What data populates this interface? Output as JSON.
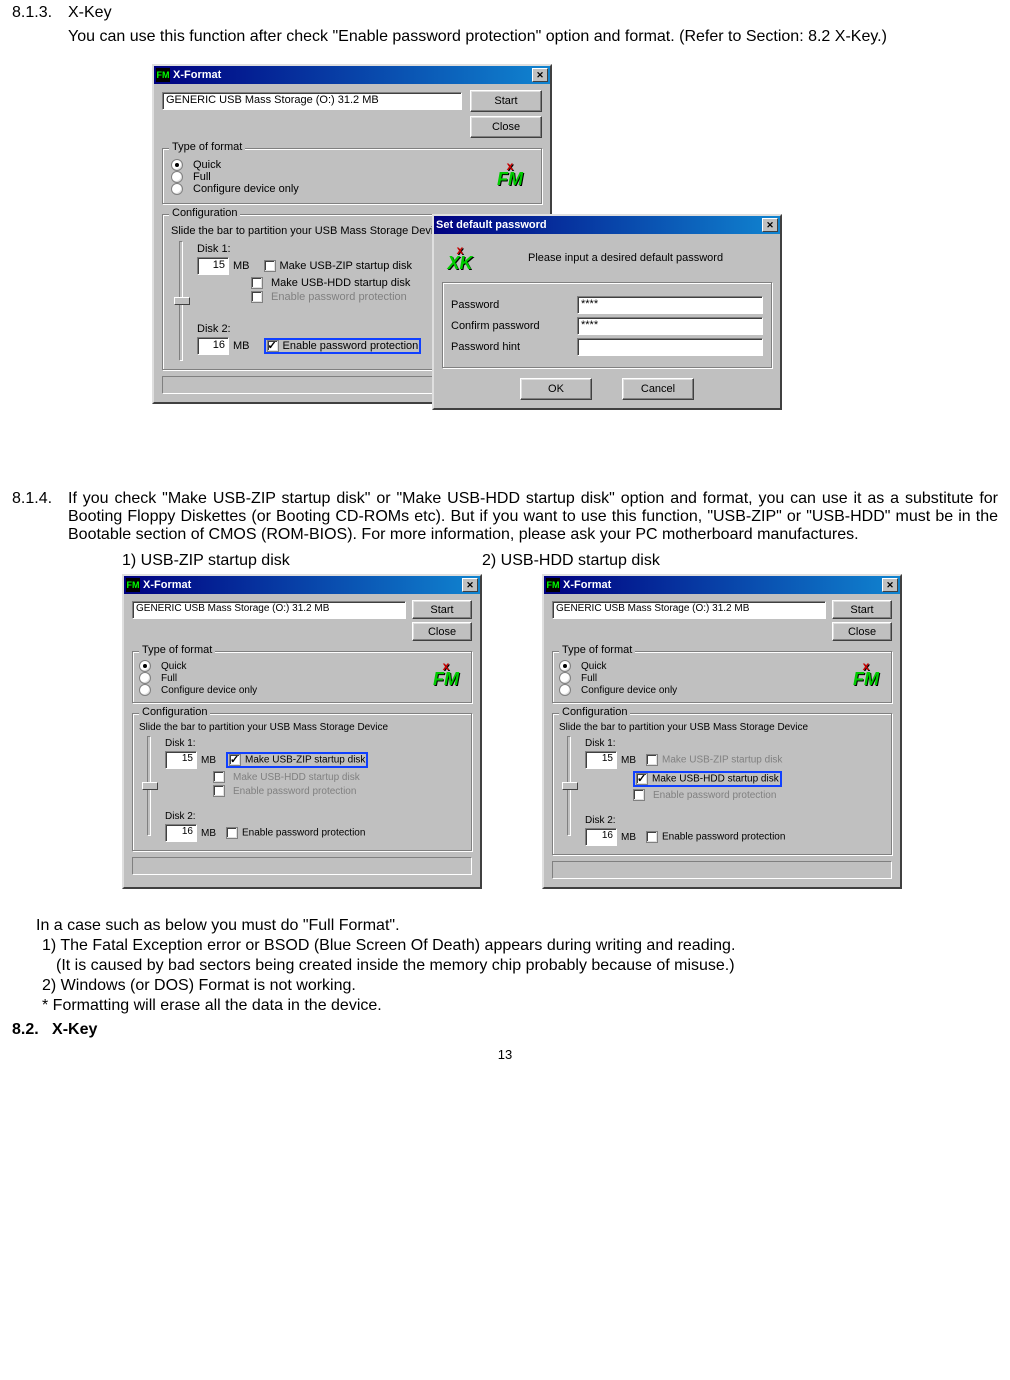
{
  "doc": {
    "sec813_num": "8.1.3.",
    "sec813_title": "X-Key",
    "sec813_body": "You can use this function after check \"Enable password protection\" option and format. (Refer to Section: 8.2 X-Key.)",
    "sec814_num": "8.1.4.",
    "sec814_body": "If you check \"Make USB-ZIP startup disk\" or \"Make USB-HDD startup disk\" option and format, you can use it as a substitute for Booting Floppy Diskettes (or Booting CD-ROMs etc). But if you want to use this function, \"USB-ZIP\" or \"USB-HDD\" must be in the Bootable section of CMOS (ROM-BIOS). For more information, please ask your PC motherboard manufactures.",
    "caption1": "1) USB-ZIP startup disk",
    "caption2": "2) USB-HDD startup disk",
    "full_format_intro": "In a case such as below you must do \"Full Format\".",
    "ff1": "1) The Fatal Exception error or BSOD (Blue Screen Of Death) appears during writing and reading.",
    "ff1_note": "(It is caused by bad sectors being created inside the memory chip probably because of misuse.)",
    "ff2": "2) Windows (or DOS) Format is not working.",
    "ff_star": "* Formatting will erase all the data in the device.",
    "sec82_num": "8.2.",
    "sec82_title": "X-Key",
    "page_number": "13"
  },
  "xformat": {
    "title": "X-Format",
    "device_label": "GENERIC USB Mass Storage (O:)  31.2 MB",
    "start_btn": "Start",
    "close_btn": "Close",
    "group_type": "Type of format",
    "opt_quick": "Quick",
    "opt_full": "Full",
    "opt_configure": "Configure device only",
    "group_conf": "Configuration",
    "conf_instr": "Slide the bar to partition your USB Mass Storage Device",
    "disk1_label": "Disk 1:",
    "disk1_val": "15",
    "mb": "MB",
    "disk2_label": "Disk 2:",
    "disk2_val": "16",
    "chk_zip": "Make USB-ZIP startup disk",
    "chk_hdd": "Make USB-HDD startup disk",
    "chk_pw": "Enable password protection",
    "logo_fm": "FM",
    "logo_x": "x"
  },
  "pw_dialog": {
    "title": "Set default password",
    "instruction": "Please input a desired default password",
    "lbl_password": "Password",
    "lbl_confirm": "Confirm password",
    "lbl_hint": "Password hint",
    "val_password": "****",
    "val_confirm": "****",
    "val_hint": "",
    "ok": "OK",
    "cancel": "Cancel",
    "logo_xk": "XK",
    "logo_x": "x"
  }
}
